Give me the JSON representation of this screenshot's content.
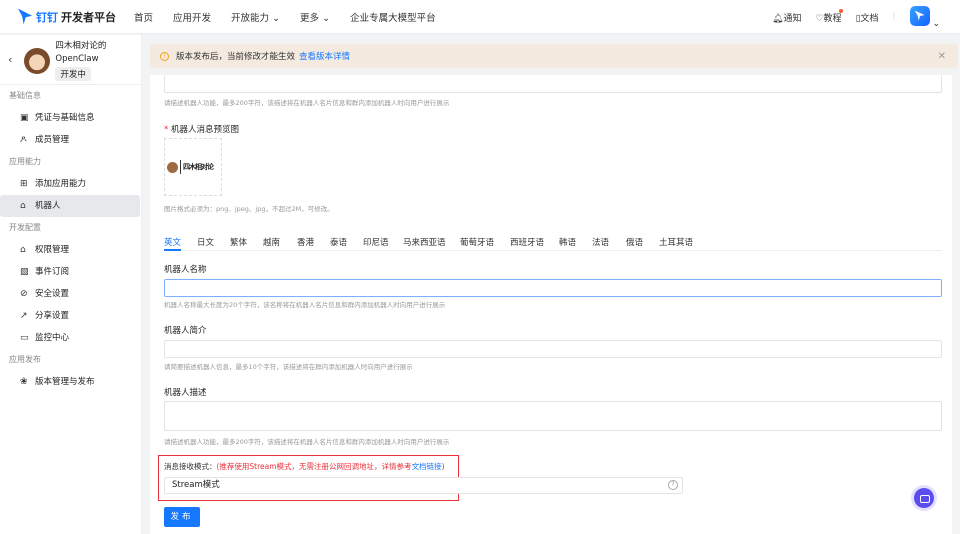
{
  "header": {
    "brand_mark": "钉钉",
    "brand_title": "开发者平台",
    "nav": [
      "首页",
      "应用开发",
      "开放能力",
      "更多",
      "企业专属大模型平台"
    ],
    "right": {
      "notify": "通知",
      "tutorial": "教程",
      "docs": "文档"
    }
  },
  "app": {
    "name_line1": "四木相对论的",
    "name_line2": "OpenClaw",
    "status": "开发中"
  },
  "sidebar": [
    {
      "section": "基础信息",
      "items": [
        "凭证与基础信息",
        "成员管理"
      ]
    },
    {
      "section": "应用能力",
      "items": [
        "添加应用能力",
        "机器人"
      ]
    },
    {
      "section": "开发配置",
      "items": [
        "权限管理",
        "事件订阅",
        "安全设置",
        "分享设置",
        "监控中心"
      ]
    },
    {
      "section": "应用发布",
      "items": [
        "版本管理与发布"
      ]
    }
  ],
  "active_item": "机器人",
  "banner": {
    "text": "版本发布后，当前修改才能生效",
    "link": "查看版本详情"
  },
  "form": {
    "top_desc_hint": "请描述机器人功能，最多200字符，该描述将在机器人名片信息和群内添加机器人时向用户进行展示",
    "preview_label": "机器人消息预览图",
    "preview_image_text": "四木相对论",
    "preview_hint": "图片格式必须为：png、jpeg、jpg，不超过2M，可修改。",
    "lang_tabs": [
      "英文",
      "日文",
      "繁体",
      "越南",
      "香港",
      "泰语",
      "印尼语",
      "马来西亚语",
      "葡萄牙语",
      "西班牙语",
      "韩语",
      "法语",
      "俄语",
      "土耳其语"
    ],
    "name_label": "机器人名称",
    "name_value": "",
    "name_hint": "机器人名称最大长度为20个字符，该名称将在机器人名片信息和群内添加机器人时向用户进行展示",
    "intro_label": "机器人简介",
    "intro_value": "",
    "intro_hint": "请简要描述机器人信息，最多10个字符，该描述将在群内添加机器人时向用户进行展示",
    "desc_label": "机器人描述",
    "desc_value": "",
    "desc_hint": "请描述机器人功能，最多200字符，该描述将在机器人名片信息和群内添加机器人时向用户进行展示",
    "mode_label": "消息接收模式：",
    "mode_note": "(推荐使用Stream模式，无需注册公网回调地址，详情参考",
    "mode_link": "文档链接",
    "mode_note_end": ")",
    "mode_value": "Stream模式",
    "publish": "发布"
  }
}
